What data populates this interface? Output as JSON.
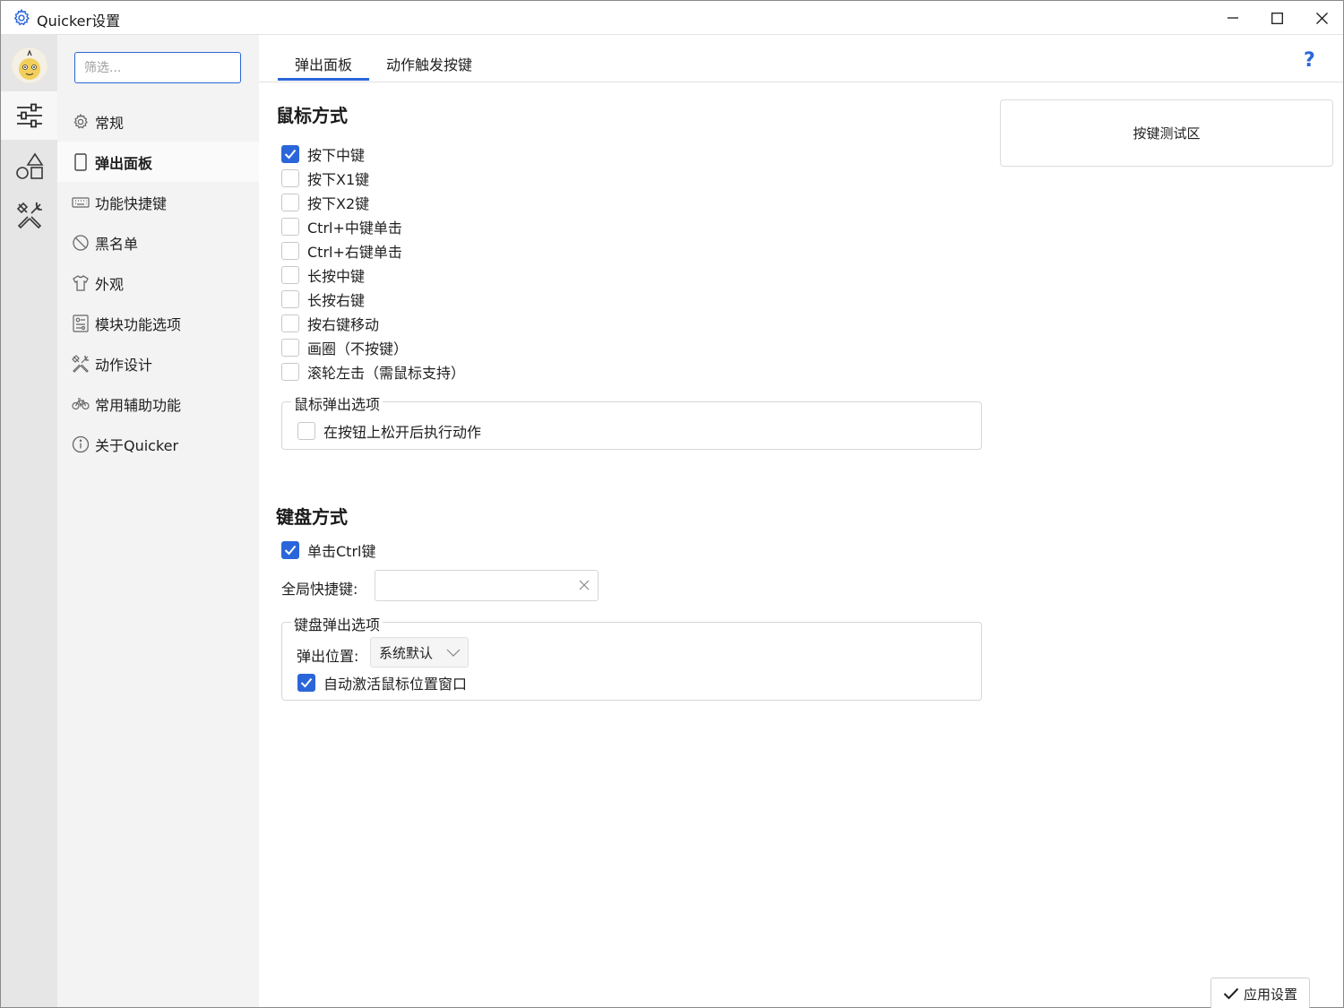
{
  "window": {
    "title": "Quicker设置",
    "controls": {
      "minimize": "minimize-icon",
      "maximize": "maximize-icon",
      "close": "close-icon"
    }
  },
  "rail": {
    "items": [
      {
        "icon": "sliders-icon",
        "active": true
      },
      {
        "icon": "shapes-icon",
        "active": false
      },
      {
        "icon": "tools-icon",
        "active": false
      }
    ]
  },
  "sidebar": {
    "filter_placeholder": "筛选...",
    "items": [
      {
        "label": "常规",
        "icon": "gear-icon"
      },
      {
        "label": "弹出面板",
        "icon": "panel-icon",
        "active": true
      },
      {
        "label": "功能快捷键",
        "icon": "keyboard-icon"
      },
      {
        "label": "黑名单",
        "icon": "block-icon"
      },
      {
        "label": "外观",
        "icon": "shirt-icon"
      },
      {
        "label": "模块功能选项",
        "icon": "module-icon"
      },
      {
        "label": "动作设计",
        "icon": "design-icon"
      },
      {
        "label": "常用辅助功能",
        "icon": "bicycle-icon"
      },
      {
        "label": "关于Quicker",
        "icon": "info-icon"
      }
    ]
  },
  "tabs": [
    {
      "label": "弹出面板",
      "active": true
    },
    {
      "label": "动作触发按键",
      "active": false
    }
  ],
  "help_label": "?",
  "mouse": {
    "title": "鼠标方式",
    "options": [
      {
        "label": "按下中键",
        "checked": true
      },
      {
        "label": "按下X1键",
        "checked": false
      },
      {
        "label": "按下X2键",
        "checked": false
      },
      {
        "label": "Ctrl+中键单击",
        "checked": false
      },
      {
        "label": "Ctrl+右键单击",
        "checked": false
      },
      {
        "label": "长按中键",
        "checked": false
      },
      {
        "label": "长按右键",
        "checked": false
      },
      {
        "label": "按右键移动",
        "checked": false
      },
      {
        "label": "画圈（不按键）",
        "checked": false
      },
      {
        "label": "滚轮左击（需鼠标支持）",
        "checked": false
      }
    ],
    "popup_group": {
      "label": "鼠标弹出选项",
      "option": {
        "label": "在按钮上松开后执行动作",
        "checked": false
      }
    }
  },
  "keyboard": {
    "title": "键盘方式",
    "single_ctrl": {
      "label": "单击Ctrl键",
      "checked": true
    },
    "hotkey_label": "全局快捷键:",
    "hotkey_value": "",
    "popup_group": {
      "label": "键盘弹出选项",
      "position_label": "弹出位置:",
      "position_value": "系统默认",
      "auto_activate": {
        "label": "自动激活鼠标位置窗口",
        "checked": true
      }
    }
  },
  "test_area": {
    "label": "按键测试区"
  },
  "apply_button": {
    "label": "应用设置"
  },
  "colors": {
    "accent": "#2a66d9",
    "rail_bg": "#e6e6e6",
    "nav_bg": "#f3f3f3"
  }
}
